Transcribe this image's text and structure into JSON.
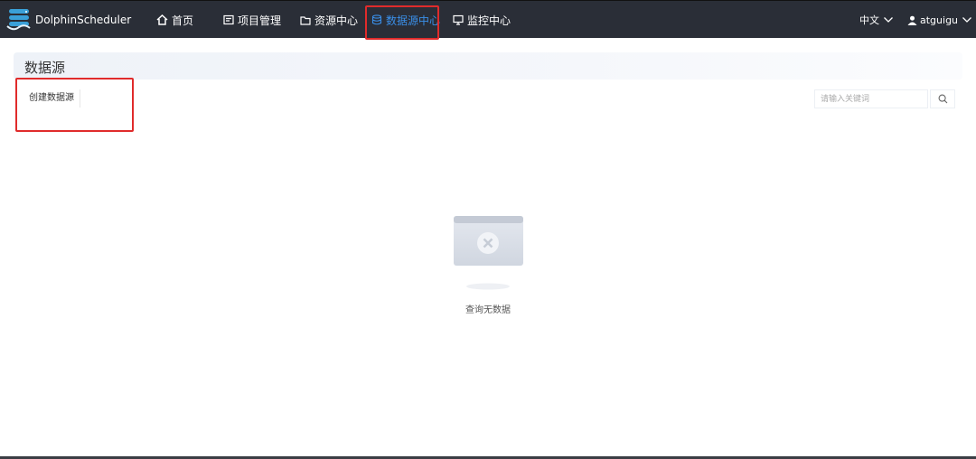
{
  "app": {
    "name": "DolphinScheduler"
  },
  "nav": {
    "items": [
      {
        "label": "首页",
        "icon": "home-icon"
      },
      {
        "label": "项目管理",
        "icon": "project-icon"
      },
      {
        "label": "资源中心",
        "icon": "folder-icon"
      },
      {
        "label": "数据源中心",
        "icon": "database-icon",
        "active": true
      },
      {
        "label": "监控中心",
        "icon": "monitor-icon"
      }
    ],
    "language": "中文",
    "user": "atguigu"
  },
  "page": {
    "title": "数据源",
    "create_button": "创建数据源",
    "search_placeholder": "请输入关键词",
    "empty_text": "查询无数据"
  },
  "colors": {
    "topbar": "#2a2e37",
    "active": "#3a8fe8",
    "highlight": "#e02b2b"
  }
}
